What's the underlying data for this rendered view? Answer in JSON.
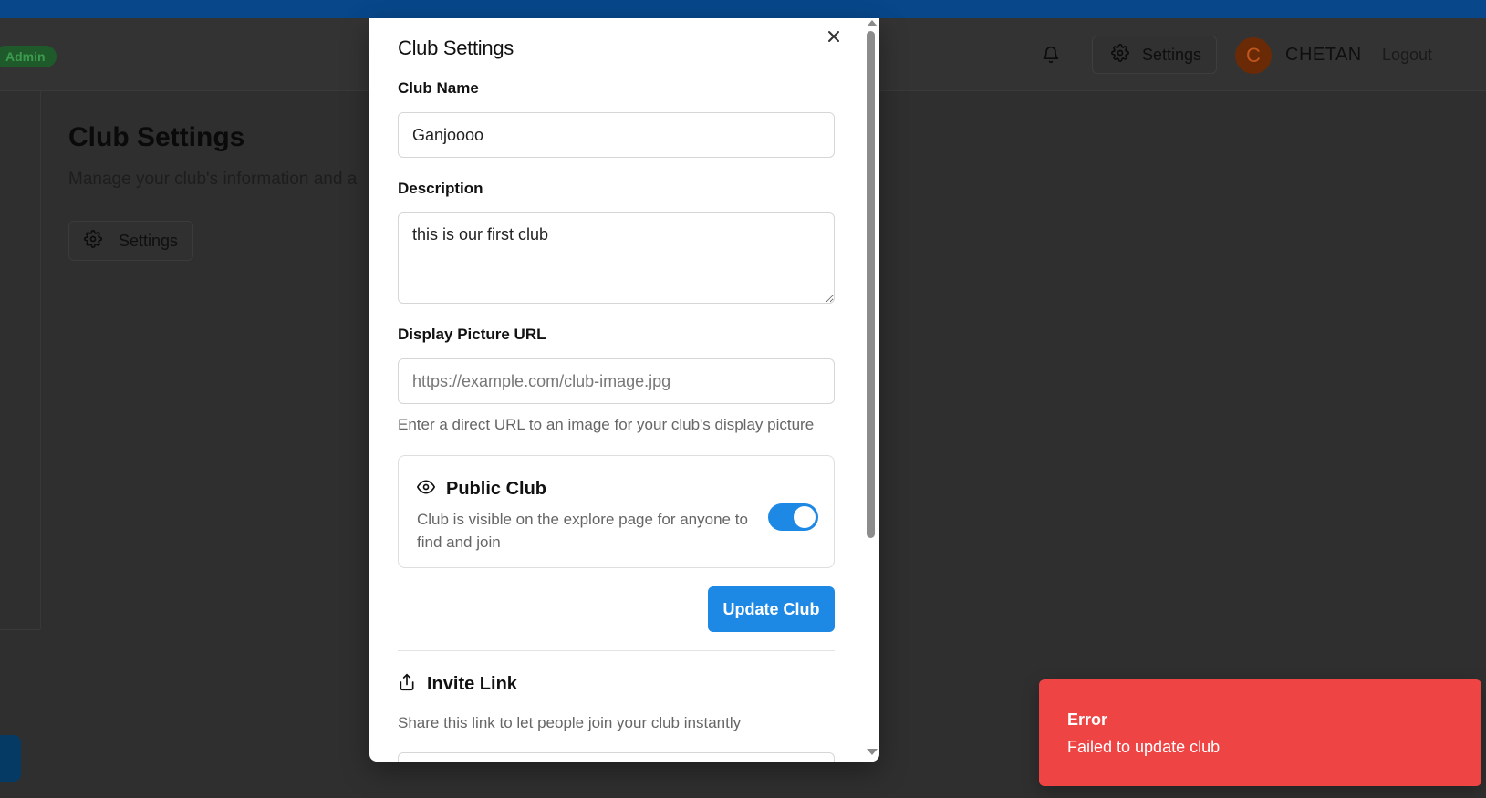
{
  "background": {
    "admin_badge": "Admin",
    "header": {
      "settings_label": "Settings",
      "avatar_initial": "C",
      "username": "CHETAN",
      "logout_label": "Logout"
    },
    "page_title": "Club Settings",
    "page_subtitle": "Manage your club's information and a",
    "settings_button_label": "Settings"
  },
  "modal": {
    "title": "Club Settings",
    "club_name": {
      "label": "Club Name",
      "value": "Ganjoooo"
    },
    "description": {
      "label": "Description",
      "value": "this is our first club"
    },
    "display_picture": {
      "label": "Display Picture URL",
      "placeholder": "https://example.com/club-image.jpg",
      "helper": "Enter a direct URL to an image for your club's display picture"
    },
    "public_club": {
      "title": "Public Club",
      "description": "Club is visible on the explore page for anyone to find and join",
      "enabled": true
    },
    "update_button_label": "Update Club",
    "invite": {
      "title": "Invite Link",
      "description": "Share this link to let people join your club instantly"
    }
  },
  "toast": {
    "title": "Error",
    "message": "Failed to update club",
    "color": "#ef4444"
  },
  "colors": {
    "accent": "#1e88e5",
    "topbar": "#07478a",
    "overlay_bg": "#2f2f2f"
  }
}
